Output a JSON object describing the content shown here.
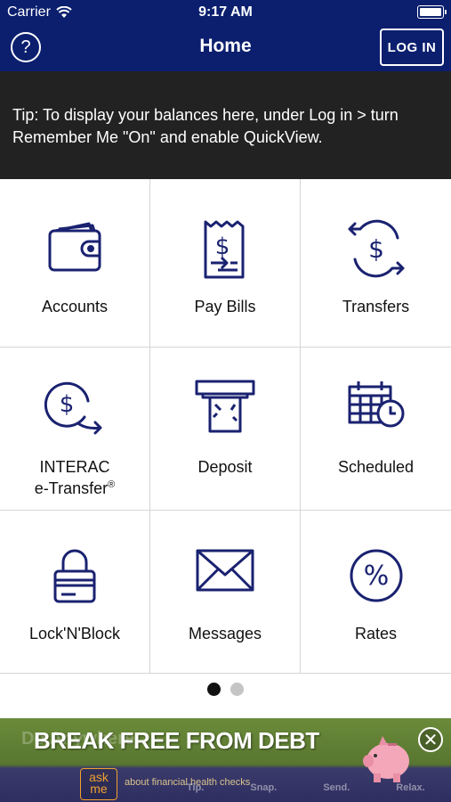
{
  "status_bar": {
    "carrier": "Carrier",
    "time": "9:17 AM"
  },
  "nav": {
    "title": "Home",
    "help_glyph": "?",
    "login_label": "LOG IN"
  },
  "tip": {
    "text": "Tip: To display your balances here, under Log in > turn Remember Me \"On\" and enable QuickView."
  },
  "tiles": [
    {
      "label": "Accounts",
      "icon": "wallet-icon"
    },
    {
      "label": "Pay Bills",
      "icon": "bill-icon"
    },
    {
      "label": "Transfers",
      "icon": "transfer-icon"
    },
    {
      "label_line1": "INTERAC",
      "label_line2": "e-Transfer",
      "label_mark": "®",
      "icon": "interac-etransfer-icon"
    },
    {
      "label": "Deposit",
      "icon": "atm-deposit-icon"
    },
    {
      "label": "Scheduled",
      "icon": "calendar-clock-icon"
    },
    {
      "label": "Lock'N'Block",
      "icon": "lock-card-icon"
    },
    {
      "label": "Messages",
      "icon": "envelope-icon"
    },
    {
      "label": "Rates",
      "icon": "percent-icon"
    }
  ],
  "pager": {
    "pages": 2,
    "active": 1
  },
  "banner": {
    "headline": "BREAK FREE FROM DEBT",
    "background_text": "Do  Anywhere",
    "askme": "ask me",
    "subtext": "about financial health checks",
    "words": [
      "Tip.",
      "Snap.",
      "Send.",
      "Relax."
    ],
    "close_glyph": "✕"
  },
  "colors": {
    "brand_navy": "#0b1f6e",
    "tip_background": "#222222",
    "icon_navy": "#1a2270"
  }
}
